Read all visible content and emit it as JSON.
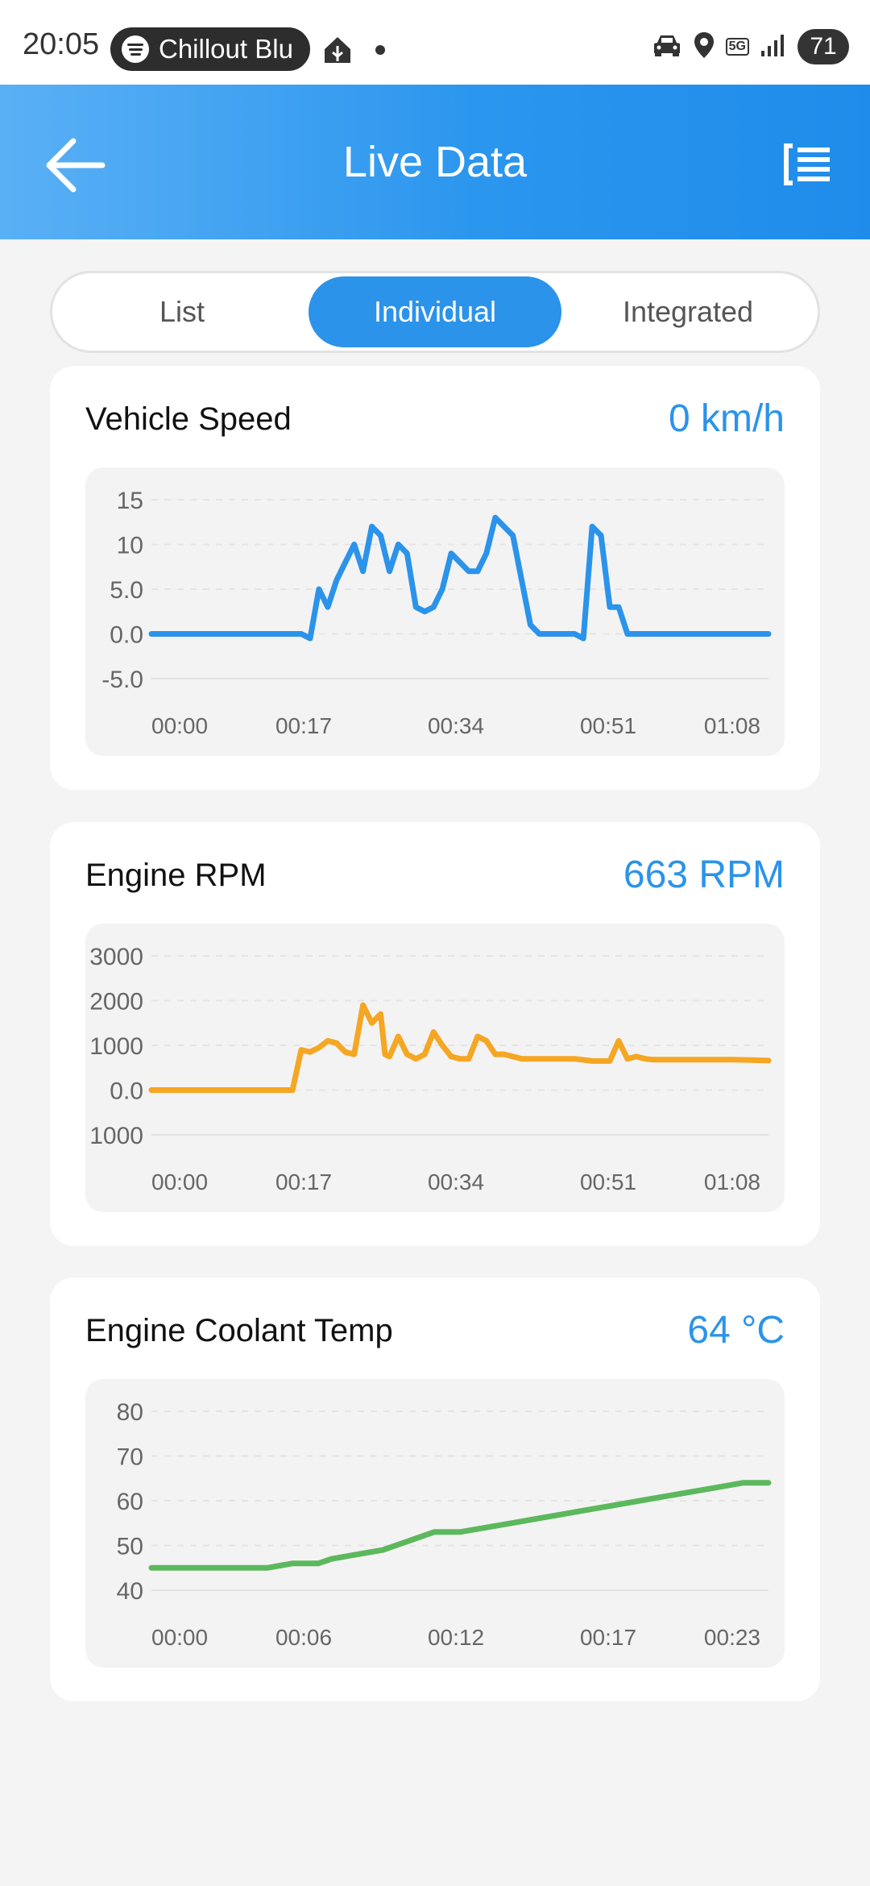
{
  "status_bar": {
    "time": "20:05",
    "media_pill": {
      "icon": "spotify-icon",
      "text": "Chillout Blu"
    },
    "network": "5G",
    "battery": "71"
  },
  "header": {
    "title": "Live Data",
    "back_icon": "arrow-left-icon",
    "menu_icon": "list-menu-icon",
    "colors": {
      "start": "#5ab0f5",
      "end": "#1f8ceb"
    }
  },
  "tabs": [
    {
      "label": "List",
      "active": false
    },
    {
      "label": "Individual",
      "active": true
    },
    {
      "label": "Integrated",
      "active": false
    }
  ],
  "cards": [
    {
      "title": "Vehicle Speed",
      "value": "0 km/h"
    },
    {
      "title": "Engine RPM",
      "value": "663 RPM"
    },
    {
      "title": "Engine Coolant Temp",
      "value": "64 °C"
    }
  ],
  "chart_data": [
    {
      "type": "line",
      "ylim": [
        -5,
        15
      ],
      "y_ticks": [
        "15",
        "10",
        "5.0",
        "0.0",
        "-5.0"
      ],
      "x_ticks": [
        "00:00",
        "00:17",
        "00:34",
        "00:51",
        "01:08"
      ],
      "xlim": [
        0,
        70
      ],
      "color": "#2b93ea",
      "series": [
        {
          "x": [
            0,
            17,
            18,
            19,
            20,
            21,
            22,
            23,
            24,
            25,
            26,
            27,
            28,
            29,
            30,
            31,
            32,
            33,
            34,
            35,
            36,
            37,
            38,
            39,
            40,
            41,
            42,
            43,
            44,
            45,
            46,
            47,
            48,
            49,
            50,
            51,
            52,
            53,
            54,
            55,
            56,
            57,
            58,
            59,
            60,
            61,
            62,
            63,
            64,
            65,
            70
          ],
          "y": [
            0,
            0,
            -0.5,
            5,
            3,
            6,
            8,
            10,
            7,
            12,
            11,
            7,
            10,
            9,
            3,
            2.5,
            3,
            5,
            9,
            8,
            7,
            7,
            9,
            13,
            12,
            11,
            6,
            1,
            0,
            0,
            0,
            0,
            0,
            -0.5,
            12,
            11,
            3,
            3,
            0,
            0,
            0,
            0,
            0,
            0,
            0,
            0,
            0,
            0,
            0,
            0,
            0
          ]
        }
      ]
    },
    {
      "type": "line",
      "ylim": [
        -1000,
        3000
      ],
      "y_ticks": [
        "3000",
        "2000",
        "1000",
        "0.0",
        "1000"
      ],
      "x_ticks": [
        "00:00",
        "00:17",
        "00:34",
        "00:51",
        "01:08"
      ],
      "xlim": [
        0,
        70
      ],
      "color": "#f5a623",
      "series": [
        {
          "x": [
            0,
            16,
            17,
            18,
            19,
            20,
            21,
            22,
            23,
            24,
            25,
            26,
            26.5,
            27,
            28,
            29,
            30,
            31,
            32,
            33,
            34,
            35,
            36,
            37,
            38,
            39,
            40,
            41,
            42,
            43,
            44,
            46,
            48,
            50,
            52,
            53,
            54,
            55,
            56,
            57,
            58,
            60,
            62,
            64,
            66,
            68,
            70
          ],
          "y": [
            0,
            0,
            900,
            850,
            950,
            1100,
            1050,
            850,
            800,
            1900,
            1500,
            1700,
            800,
            750,
            1200,
            800,
            700,
            800,
            1300,
            1000,
            750,
            700,
            700,
            1200,
            1100,
            800,
            800,
            750,
            700,
            700,
            700,
            700,
            700,
            650,
            650,
            1100,
            700,
            750,
            700,
            680,
            680,
            680,
            680,
            680,
            680,
            670,
            660
          ]
        }
      ]
    },
    {
      "type": "line",
      "ylim": [
        40,
        80
      ],
      "y_ticks": [
        "80",
        "70",
        "60",
        "50",
        "40"
      ],
      "x_ticks": [
        "00:00",
        "00:06",
        "00:12",
        "00:17",
        "00:23"
      ],
      "xlim": [
        0,
        24
      ],
      "color": "#5cb85c",
      "series": [
        {
          "x": [
            0,
            3,
            4,
            4.5,
            5,
            5.5,
            6,
            6.5,
            7,
            8,
            8.5,
            9,
            10,
            11,
            11.5,
            12,
            12.5,
            13,
            14,
            15,
            16,
            17,
            18,
            19,
            20,
            21,
            22,
            23,
            24
          ],
          "y": [
            45,
            45,
            45,
            45,
            45.5,
            46,
            46,
            46,
            47,
            48,
            48.5,
            49,
            51,
            53,
            53,
            53,
            53.5,
            54,
            55,
            56,
            57,
            58,
            59,
            60,
            61,
            62,
            63,
            64,
            64
          ]
        }
      ]
    }
  ]
}
